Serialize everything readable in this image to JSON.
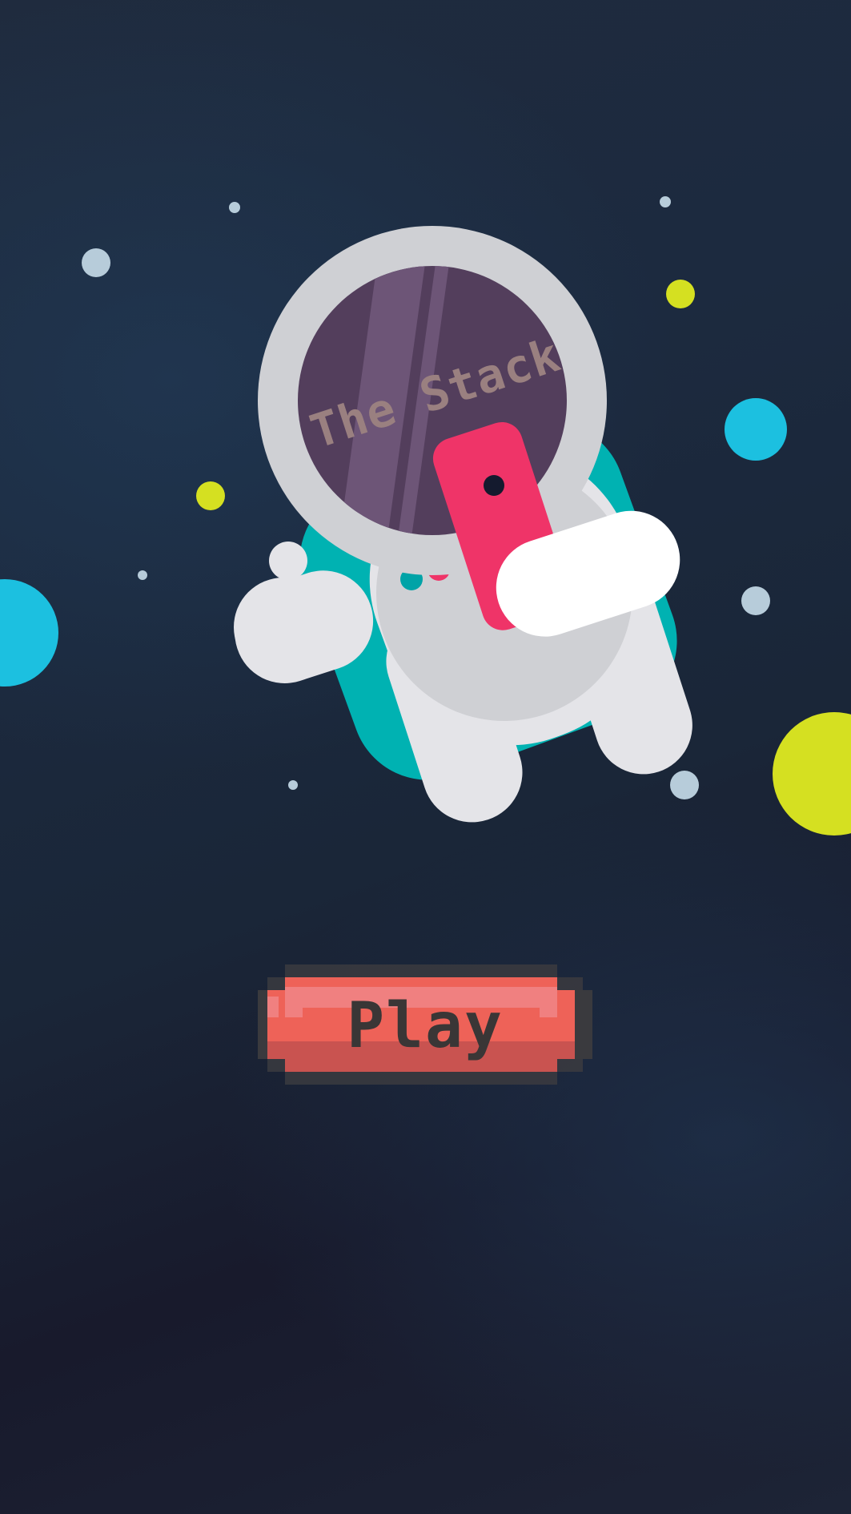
{
  "game": {
    "title": "The Stack",
    "play_label": "Play"
  },
  "colors": {
    "background": "#1b2536",
    "planet_cyan": "#1cc0e0",
    "planet_yellow": "#d5e021",
    "star_pale": "#b7ccda",
    "suit_white": "#e4e4e8",
    "suit_grey": "#cfd0d4",
    "backpack_teal": "#00b2b2",
    "visor_purple": "#533e5c",
    "phone_pink": "#ef3468",
    "button_red": "#ee6258"
  },
  "icons": {
    "mascot": "astronaut-holding-phone-icon"
  }
}
